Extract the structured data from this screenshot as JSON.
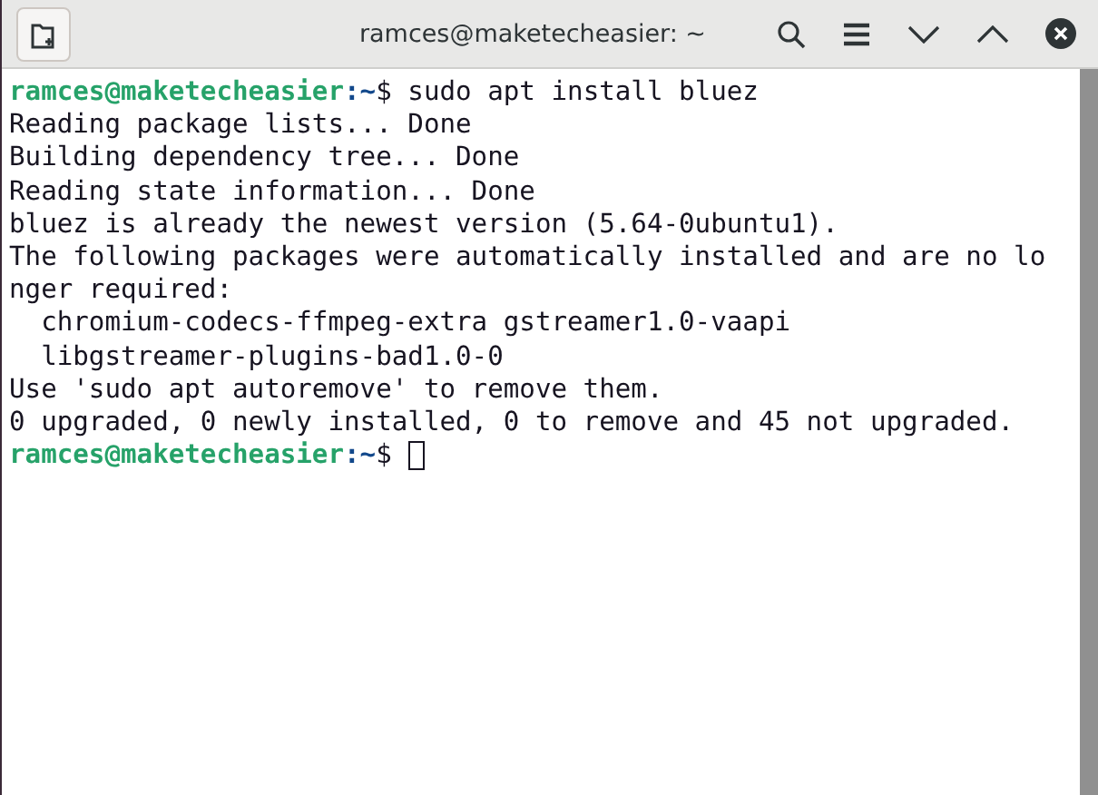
{
  "window": {
    "title": "ramces@maketecheasier: ~"
  },
  "terminal": {
    "lines": [
      {
        "kind": "prompt",
        "user_host": "ramces@maketecheasier",
        "path": ":~",
        "symbol": "$",
        "command": "sudo apt install bluez",
        "cursor": false
      },
      {
        "kind": "output",
        "text": "Reading package lists... Done"
      },
      {
        "kind": "output",
        "text": "Building dependency tree... Done"
      },
      {
        "kind": "output",
        "text": "Reading state information... Done"
      },
      {
        "kind": "output",
        "text": "bluez is already the newest version (5.64-0ubuntu1)."
      },
      {
        "kind": "output",
        "text": "The following packages were automatically installed and are no lo"
      },
      {
        "kind": "output",
        "text": "nger required:"
      },
      {
        "kind": "output",
        "text": "  chromium-codecs-ffmpeg-extra gstreamer1.0-vaapi"
      },
      {
        "kind": "output",
        "text": "  libgstreamer-plugins-bad1.0-0"
      },
      {
        "kind": "output",
        "text": "Use 'sudo apt autoremove' to remove them."
      },
      {
        "kind": "output",
        "text": "0 upgraded, 0 newly installed, 0 to remove and 45 not upgraded."
      },
      {
        "kind": "prompt",
        "user_host": "ramces@maketecheasier",
        "path": ":~",
        "symbol": "$",
        "cursor": true
      }
    ]
  }
}
